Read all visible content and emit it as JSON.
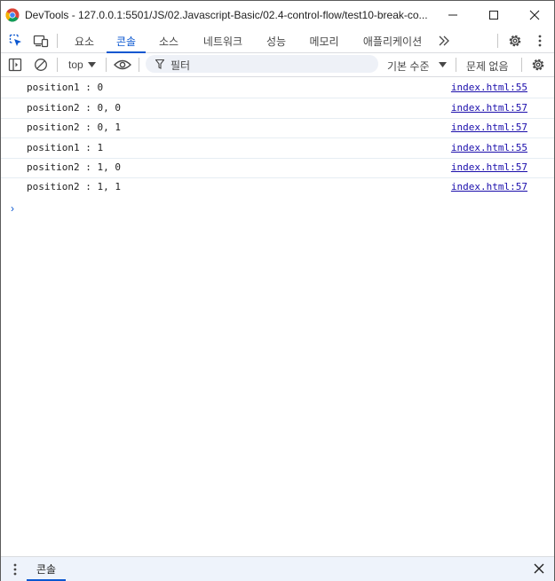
{
  "window": {
    "title": "DevTools - 127.0.0.1:5501/JS/02.Javascript-Basic/02.4-control-flow/test10-break-co...",
    "controls": [
      "minimize-icon",
      "maximize-icon",
      "close-icon"
    ]
  },
  "tabs": {
    "items": [
      {
        "label": "요소",
        "active": false
      },
      {
        "label": "콘솔",
        "active": true
      },
      {
        "label": "소스",
        "active": false
      },
      {
        "label": "네트워크",
        "active": false
      },
      {
        "label": "성능",
        "active": false
      },
      {
        "label": "메모리",
        "active": false
      },
      {
        "label": "애플리케이션",
        "active": false
      }
    ],
    "more_icon": "chevron-double-right-icon",
    "left_icons": [
      "inspect-element-icon",
      "device-toggle-icon"
    ],
    "right_icons": [
      "gear-icon",
      "kebab-menu-icon"
    ]
  },
  "console_toolbar": {
    "context": "top",
    "filter_placeholder": "필터",
    "log_level": "기본 수준",
    "issues": "문제 없음"
  },
  "console": {
    "messages": [
      {
        "text": "position1 : 0",
        "source": "index.html:55"
      },
      {
        "text": "position2 : 0, 0",
        "source": "index.html:57"
      },
      {
        "text": "position2 : 0, 1",
        "source": "index.html:57"
      },
      {
        "text": "position1 : 1",
        "source": "index.html:55"
      },
      {
        "text": "position2 : 1, 0",
        "source": "index.html:57"
      },
      {
        "text": "position2 : 1, 1",
        "source": "index.html:57"
      }
    ],
    "prompt_symbol": "›"
  },
  "drawer": {
    "tab_label": "콘솔"
  },
  "colors": {
    "accent": "#0b57d0",
    "link": "#1a0dab",
    "drawer_bg": "#eef3fb"
  }
}
